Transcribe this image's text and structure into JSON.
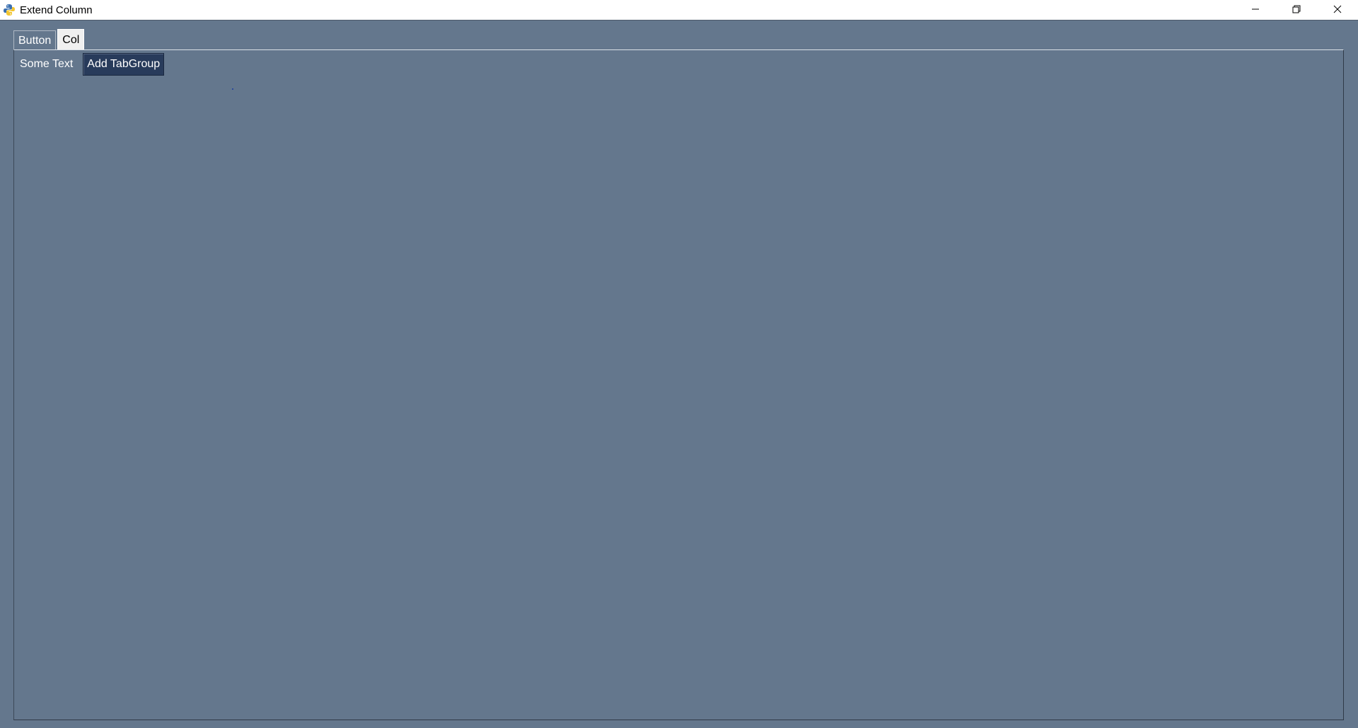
{
  "window": {
    "title": "Extend Column",
    "icon": "python-icon",
    "controls": [
      "minimize-icon",
      "restore-icon",
      "close-icon"
    ]
  },
  "tabs": [
    {
      "label": "Button",
      "active": false
    },
    {
      "label": "Col",
      "active": true
    }
  ],
  "panel": {
    "text": "Some Text",
    "button_label": "Add TabGroup"
  },
  "colors": {
    "background": "#64778d",
    "button_bg": "#283b5b",
    "text": "#ffffff"
  }
}
